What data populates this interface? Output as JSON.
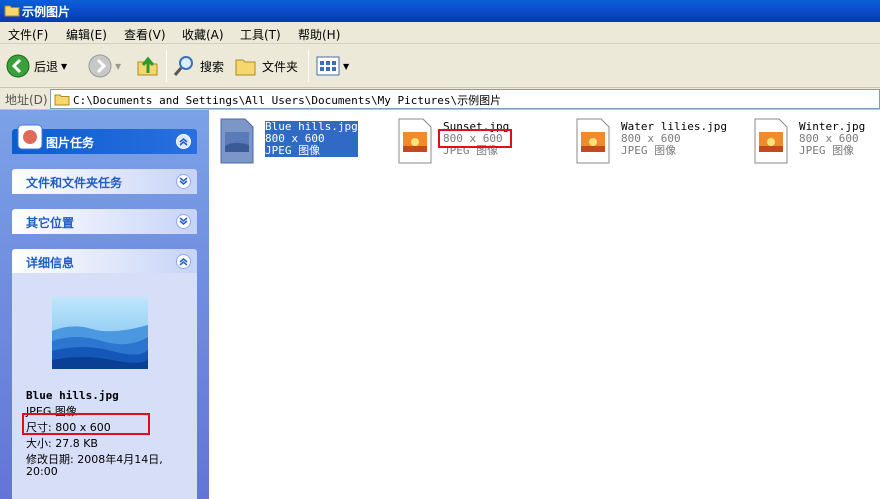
{
  "window": {
    "title": "示例图片"
  },
  "menu": [
    "文件(F)",
    "编辑(E)",
    "查看(V)",
    "收藏(A)",
    "工具(T)",
    "帮助(H)"
  ],
  "toolbar": {
    "back": "后退",
    "search": "搜索",
    "folders": "文件夹"
  },
  "address": {
    "label": "地址(D)",
    "path": "C:\\Documents and Settings\\All Users\\Documents\\My Pictures\\示例图片"
  },
  "tasks": {
    "picture_tasks": "图片任务",
    "file_folder_tasks": "文件和文件夹任务",
    "other_places": "其它位置",
    "details": "详细信息"
  },
  "details": {
    "name": "Blue hills.jpg",
    "type": "JPEG 图像",
    "dimensions": "尺寸: 800 x 600",
    "size": "大小: 27.8 KB",
    "modified_line1": "修改日期: 2008年4月14日,",
    "modified_line2": "20:00"
  },
  "files": [
    {
      "name": "Blue hills.jpg",
      "dims": "800 x 600",
      "type": "JPEG 图像",
      "selected": true
    },
    {
      "name": "Sunset.jpg",
      "dims": "800 x 600",
      "type": "JPEG 图像",
      "selected": false
    },
    {
      "name": "Water lilies.jpg",
      "dims": "800 x 600",
      "type": "JPEG 图像",
      "selected": false
    },
    {
      "name": "Winter.jpg",
      "dims": "800 x 600",
      "type": "JPEG 图像",
      "selected": false
    }
  ],
  "colors": {
    "highlight": "#e0101a",
    "selection": "#316ac5",
    "titlebar": "#0a48c6"
  }
}
